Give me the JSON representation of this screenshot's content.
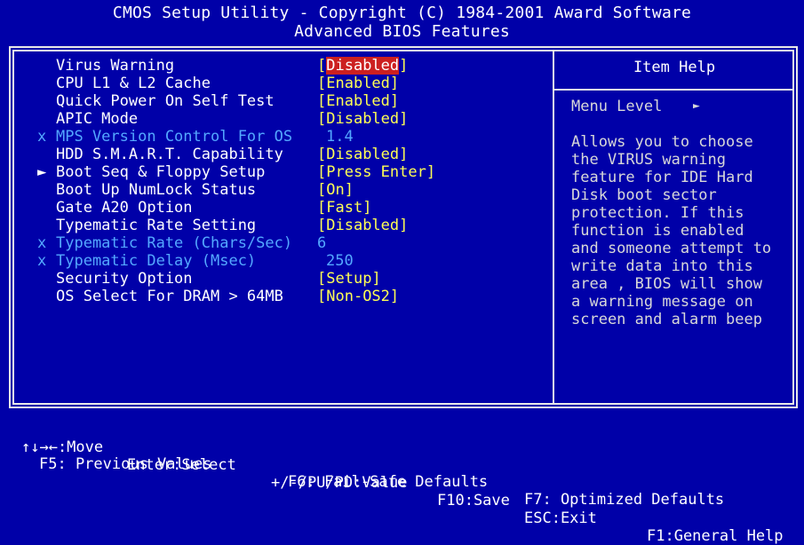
{
  "header": {
    "line1": "CMOS Setup Utility - Copyright (C) 1984-2001 Award Software",
    "line2": "Advanced BIOS Features"
  },
  "settings": [
    {
      "marker": "",
      "label": "Virus Warning",
      "value": "Disabled",
      "state": "selected"
    },
    {
      "marker": "",
      "label": "CPU L1 & L2 Cache",
      "value": "Enabled",
      "state": "normal"
    },
    {
      "marker": "",
      "label": "Quick Power On Self Test",
      "value": "Enabled",
      "state": "normal"
    },
    {
      "marker": "",
      "label": "APIC Mode",
      "value": "Disabled",
      "state": "normal"
    },
    {
      "marker": "x",
      "label": "MPS Version Control For OS",
      "value": "1.4",
      "state": "disabled"
    },
    {
      "marker": "",
      "label": "HDD S.M.A.R.T. Capability",
      "value": "Disabled",
      "state": "normal"
    },
    {
      "marker": "►",
      "label": "Boot Seq & Floppy Setup",
      "value": "Press Enter",
      "state": "normal"
    },
    {
      "marker": "",
      "label": "Boot Up NumLock Status",
      "value": "On",
      "state": "normal"
    },
    {
      "marker": "",
      "label": "Gate A20 Option",
      "value": "Fast",
      "state": "normal"
    },
    {
      "marker": "",
      "label": "Typematic Rate Setting",
      "value": "Disabled",
      "state": "normal"
    },
    {
      "marker": "x",
      "label": "Typematic Rate (Chars/Sec)",
      "value": "6",
      "state": "disabled"
    },
    {
      "marker": "x",
      "label": "Typematic Delay (Msec)",
      "value": "250",
      "state": "disabled"
    },
    {
      "marker": "",
      "label": "Security Option",
      "value": "Setup",
      "state": "normal"
    },
    {
      "marker": "",
      "label": "OS Select For DRAM > 64MB",
      "value": "Non-OS2",
      "state": "normal"
    }
  ],
  "help": {
    "title": "Item Help",
    "menu_level": "Menu Level",
    "menu_level_icon": "right-triangle-icon",
    "lines": [
      "Allows you to choose",
      "the VIRUS warning",
      "feature for IDE Hard",
      "Disk boot sector",
      "protection. If this",
      "function is enabled",
      "and someone attempt to",
      "write data into this",
      "area , BIOS will show",
      "a warning message on",
      "screen and alarm beep"
    ]
  },
  "footer": {
    "move": "↑↓→←:Move",
    "enter": "Enter:Select",
    "value": "+/-/PU/PD:Value",
    "save": "F10:Save",
    "exit": "ESC:Exit",
    "help": "F1:General Help",
    "prev": "F5: Previous Values",
    "failsafe": "F6: Fail-Safe Defaults",
    "optimized": "F7: Optimized Defaults"
  },
  "colors": {
    "background": "#0000a8",
    "value": "#ffff54",
    "disabled": "#54a8ff",
    "selection": "#cc2020",
    "text": "#ffffff"
  }
}
